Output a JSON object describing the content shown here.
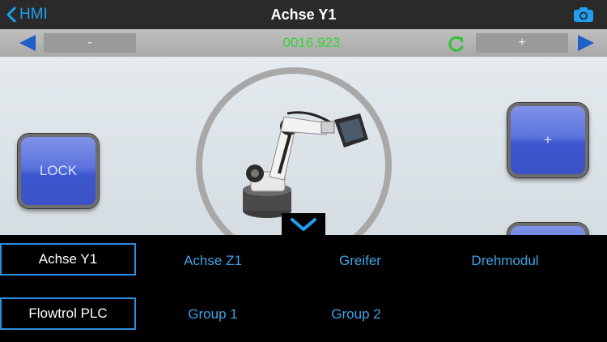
{
  "navbar": {
    "back_label": "HMI",
    "title": "Achse Y1",
    "camera_icon": "camera-icon",
    "accent_color": "#1e9ff2"
  },
  "valuebar": {
    "left_arrow_icon": "arrow-left-icon",
    "minus_label": "-",
    "value": "0016.923",
    "value_color": "#39d339",
    "refresh_icon": "refresh-icon",
    "plus_label": "+",
    "right_arrow_icon": "arrow-right-icon"
  },
  "main": {
    "lock_label": "LOCK",
    "plus_button_label": "+",
    "minus_button_label": "",
    "robot_image": "industrial-robot-arm",
    "expand_icon": "chevron-down-icon",
    "button_color": "#4a64d6"
  },
  "panel": {
    "axes": [
      "Achse Y1",
      "Achse Z1",
      "Greifer",
      "Drehmodul"
    ],
    "groups": [
      "Flowtrol PLC",
      "Group 1",
      "Group 2"
    ],
    "selected_axis": "Achse Y1",
    "selected_group": "Flowtrol PLC"
  }
}
